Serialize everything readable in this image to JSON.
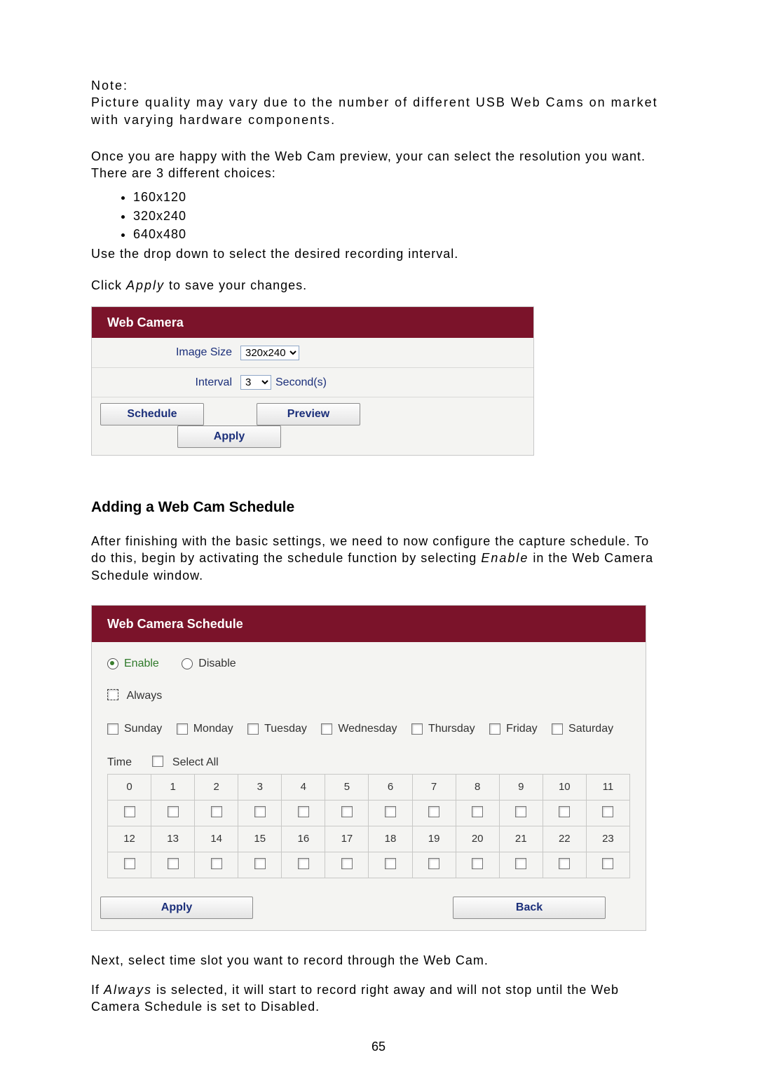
{
  "note": {
    "label": "Note:",
    "body": "Picture quality may vary due to the number of different USB Web Cams on market with varying hardware components."
  },
  "intro": {
    "happy": "Once you are happy with the Web Cam preview, your can select the resolution you want. There are 3 different choices:",
    "choices": [
      "160x120",
      "320x240",
      "640x480"
    ],
    "dropdown_instr": "Use the drop down to select the desired recording interval.",
    "click_prefix": "Click ",
    "apply_word": "Apply",
    "click_suffix": " to save your changes."
  },
  "webcam_panel": {
    "title": "Web Camera",
    "image_size_label": "Image Size",
    "image_size_value": "320x240",
    "interval_label": "Interval",
    "interval_value": "3",
    "interval_suffix": "Second(s)",
    "buttons": {
      "schedule": "Schedule",
      "preview": "Preview",
      "apply": "Apply"
    }
  },
  "section2_heading": "Adding a Web Cam Schedule",
  "section2_para_prefix": "After finishing with the basic settings, we need to now configure the capture schedule. To do this, begin by activating the schedule function by selecting ",
  "section2_enable_word": "Enable",
  "section2_para_suffix": " in the Web Camera Schedule window.",
  "sched_panel": {
    "title": "Web Camera Schedule",
    "enable": "Enable",
    "disable": "Disable",
    "always": "Always",
    "days": [
      "Sunday",
      "Monday",
      "Tuesday",
      "Wednesday",
      "Thursday",
      "Friday",
      "Saturday"
    ],
    "time_label": "Time",
    "select_all": "Select All",
    "hours_row1": [
      "0",
      "1",
      "2",
      "3",
      "4",
      "5",
      "6",
      "7",
      "8",
      "9",
      "10",
      "11"
    ],
    "hours_row2": [
      "12",
      "13",
      "14",
      "15",
      "16",
      "17",
      "18",
      "19",
      "20",
      "21",
      "22",
      "23"
    ],
    "buttons": {
      "apply": "Apply",
      "back": "Back"
    }
  },
  "after_sched": {
    "p1": "Next, select time slot you want to record through the Web Cam.",
    "p2_prefix": "If ",
    "always_word": "Always",
    "p2_suffix": " is selected, it will start to record right away and will not stop until the Web Camera Schedule is set to Disabled."
  },
  "page_number": "65"
}
